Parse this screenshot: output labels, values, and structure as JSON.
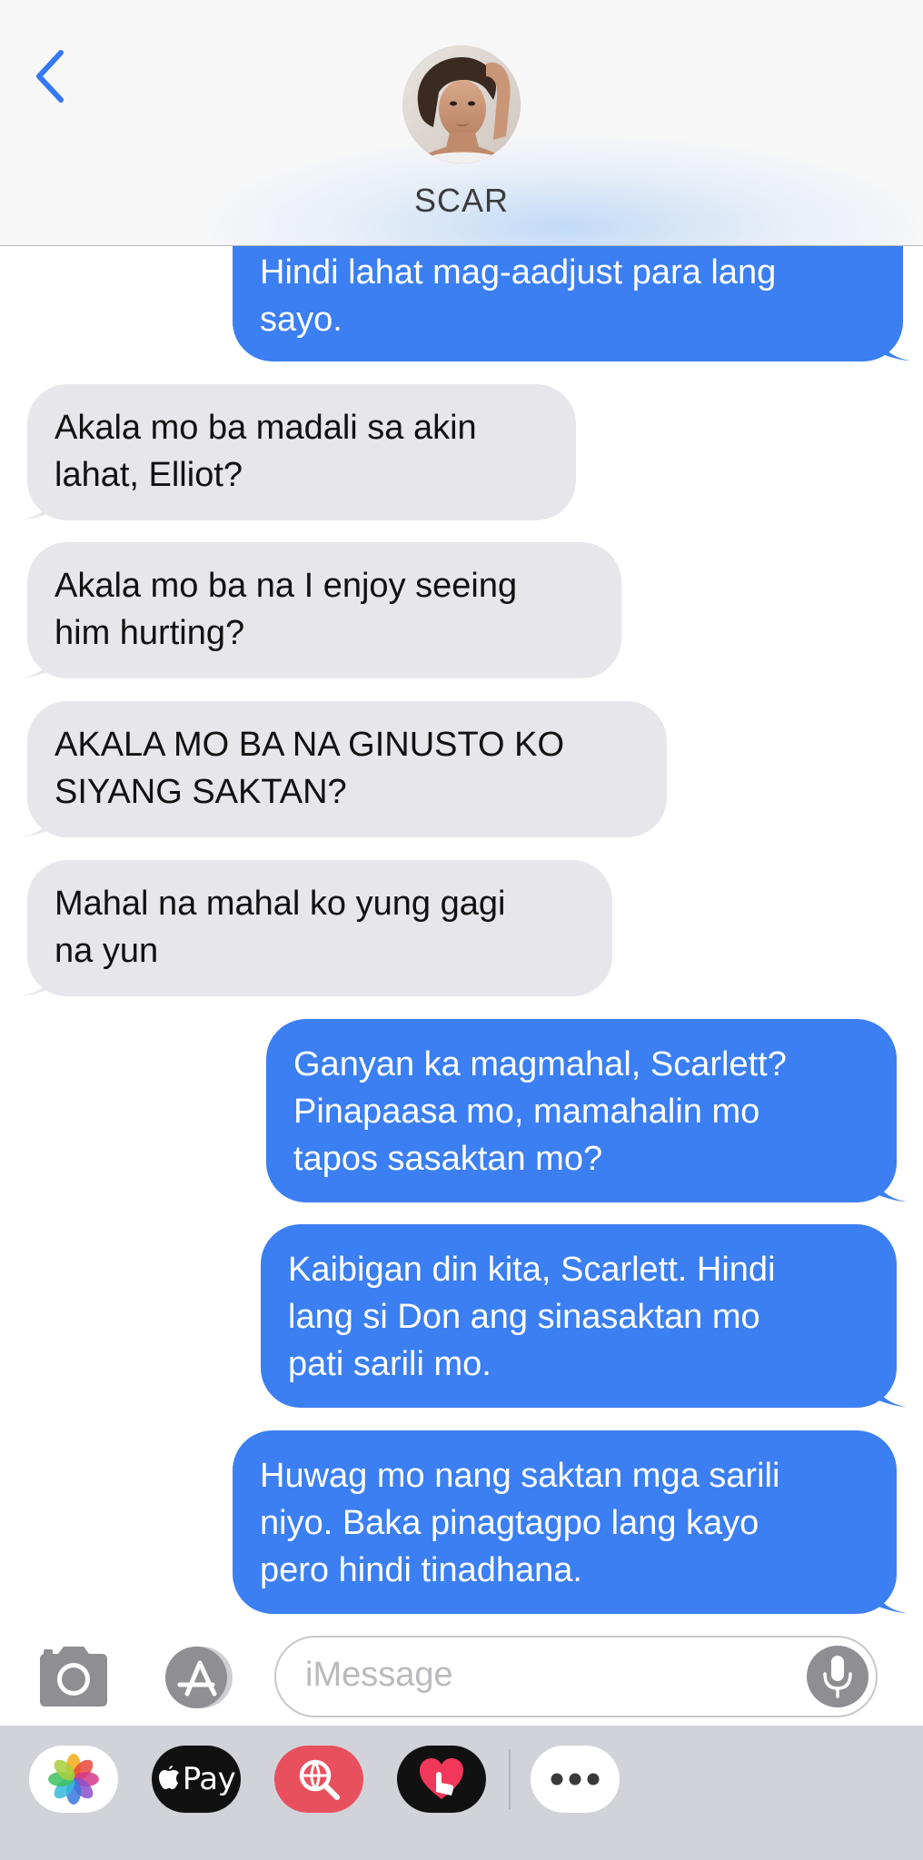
{
  "header": {
    "contact_name": "SCAR",
    "back_icon": "chevron-left-icon",
    "avatar_icon": "contact-avatar-photo"
  },
  "messages": [
    {
      "direction": "outgoing",
      "lines": [
        "Hindi lahat mag-aadjust para lang",
        "sayo."
      ]
    },
    {
      "direction": "incoming",
      "lines": [
        "Akala mo ba madali sa akin",
        "lahat, Elliot?"
      ]
    },
    {
      "direction": "incoming",
      "lines": [
        "Akala mo ba na I enjoy seeing",
        "him hurting?"
      ]
    },
    {
      "direction": "incoming",
      "lines": [
        "AKALA MO BA NA GINUSTO KO",
        "SIYANG SAKTAN?"
      ]
    },
    {
      "direction": "incoming",
      "lines": [
        "Mahal na mahal ko yung gagi",
        "na yun"
      ]
    },
    {
      "direction": "outgoing",
      "lines": [
        "Ganyan ka magmahal, Scarlett?",
        "Pinapaasa mo, mamahalin mo",
        "tapos sasaktan mo?"
      ]
    },
    {
      "direction": "outgoing",
      "lines": [
        "Kaibigan din kita, Scarlett. Hindi",
        "lang si Don ang sinasaktan mo",
        "pati sarili mo."
      ]
    },
    {
      "direction": "outgoing",
      "lines": [
        "Huwag mo nang saktan mga sarili",
        "niyo. Baka pinagtagpo lang kayo",
        "pero hindi tinadhana."
      ]
    }
  ],
  "input_bar": {
    "placeholder": "iMessage",
    "camera_icon": "camera-icon",
    "apps_icon": "app-store-icon",
    "mic_icon": "microphone-icon"
  },
  "app_drawer": {
    "apps": [
      {
        "name": "photos-app-icon"
      },
      {
        "name": "apple-pay-app-icon",
        "label": "Pay"
      },
      {
        "name": "web-image-search-app-icon"
      },
      {
        "name": "digital-touch-app-icon"
      },
      {
        "name": "more-apps-icon"
      }
    ]
  },
  "colors": {
    "outgoing_bubble": "#3b7ff2",
    "incoming_bubble": "#e6e6eb",
    "accent": "#3478f6"
  }
}
